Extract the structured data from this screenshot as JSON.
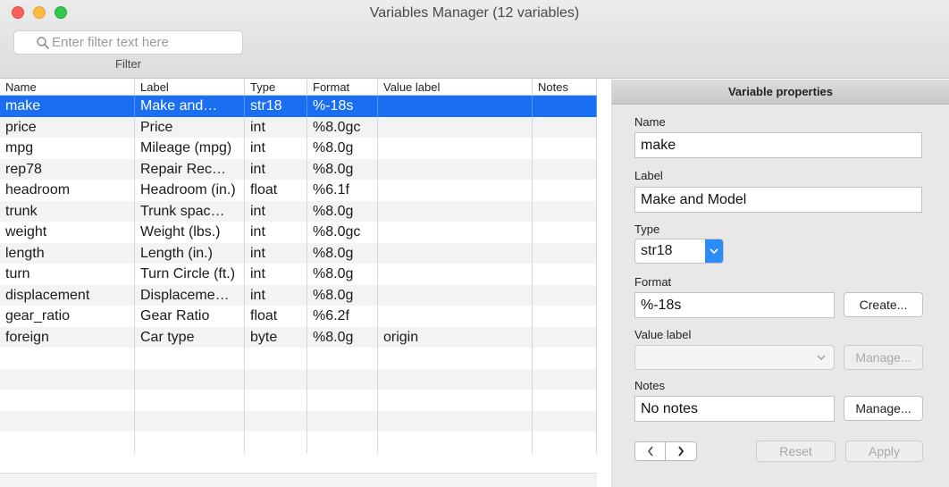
{
  "window": {
    "title": "Variables Manager (12 variables)"
  },
  "filter": {
    "placeholder": "Enter filter text here",
    "caption": "Filter"
  },
  "table": {
    "columns": [
      "Name",
      "Label",
      "Type",
      "Format",
      "Value label",
      "Notes"
    ],
    "rows": [
      [
        "make",
        "Make and…",
        "str18",
        "%-18s",
        "",
        ""
      ],
      [
        "price",
        "Price",
        "int",
        "%8.0gc",
        "",
        ""
      ],
      [
        "mpg",
        "Mileage (mpg)",
        "int",
        "%8.0g",
        "",
        ""
      ],
      [
        "rep78",
        "Repair Rec…",
        "int",
        "%8.0g",
        "",
        ""
      ],
      [
        "headroom",
        "Headroom (in.)",
        "float",
        "%6.1f",
        "",
        ""
      ],
      [
        "trunk",
        "Trunk spac…",
        "int",
        "%8.0g",
        "",
        ""
      ],
      [
        "weight",
        "Weight (lbs.)",
        "int",
        "%8.0gc",
        "",
        ""
      ],
      [
        "length",
        "Length (in.)",
        "int",
        "%8.0g",
        "",
        ""
      ],
      [
        "turn",
        "Turn Circle (ft.)",
        "int",
        "%8.0g",
        "",
        ""
      ],
      [
        "displacement",
        "Displaceme…",
        "int",
        "%8.0g",
        "",
        ""
      ],
      [
        "gear_ratio",
        "Gear Ratio",
        "float",
        "%6.2f",
        "",
        ""
      ],
      [
        "foreign",
        "Car type",
        "byte",
        "%8.0g",
        "origin",
        ""
      ]
    ],
    "selected_index": 0,
    "empty_rows": 5
  },
  "properties": {
    "header": "Variable properties",
    "name_label": "Name",
    "name_value": "make",
    "label_label": "Label",
    "label_value": "Make and Model",
    "type_label": "Type",
    "type_value": "str18",
    "format_label": "Format",
    "format_value": "%-18s",
    "create_button": "Create...",
    "value_label_label": "Value label",
    "value_label_value": "",
    "value_label_manage_button": "Manage...",
    "notes_label": "Notes",
    "notes_value": "No notes",
    "notes_manage_button": "Manage...",
    "reset_button": "Reset",
    "apply_button": "Apply"
  },
  "colors": {
    "selection": "#1a6ef2",
    "accent": "#2d8bf7"
  },
  "icons": [
    "search-icon",
    "chevron-down-icon",
    "chevron-left-icon",
    "chevron-right-icon"
  ]
}
